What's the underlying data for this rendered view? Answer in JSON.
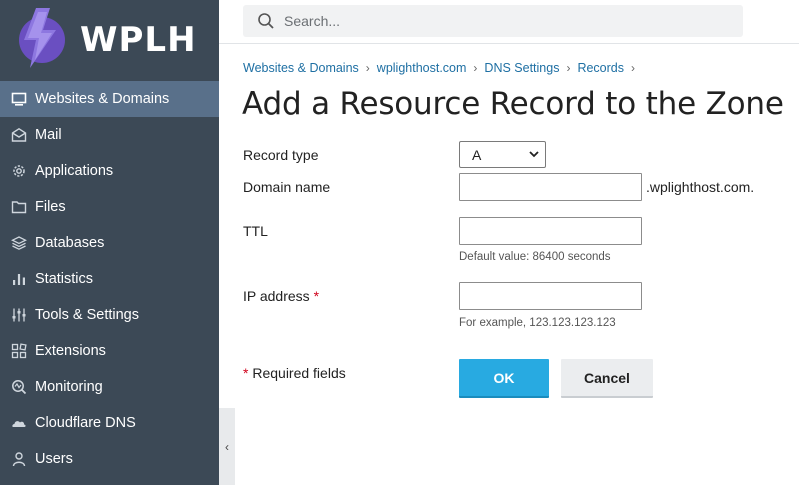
{
  "brand": {
    "logo_text": "WPLH",
    "accent": "#28aae1",
    "sidebar_bg": "#3c4956",
    "active_bg": "#59708a"
  },
  "search": {
    "placeholder": "Search..."
  },
  "sidebar": {
    "items": [
      {
        "label": "Websites & Domains",
        "icon": "monitor-icon",
        "active": true
      },
      {
        "label": "Mail",
        "icon": "envelope-icon"
      },
      {
        "label": "Applications",
        "icon": "gear-icon"
      },
      {
        "label": "Files",
        "icon": "folder-icon"
      },
      {
        "label": "Databases",
        "icon": "layers-icon"
      },
      {
        "label": "Statistics",
        "icon": "bar-chart-icon"
      },
      {
        "label": "Tools & Settings",
        "icon": "sliders-icon"
      },
      {
        "label": "Extensions",
        "icon": "extensions-icon"
      },
      {
        "label": "Monitoring",
        "icon": "monitoring-icon"
      },
      {
        "label": "Cloudflare DNS",
        "icon": "cloud-icon"
      },
      {
        "label": "Users",
        "icon": "user-icon"
      }
    ],
    "collapse_glyph": "‹"
  },
  "breadcrumb": [
    "Websites & Domains",
    "wplighthost.com",
    "DNS Settings",
    "Records"
  ],
  "breadcrumb_sep": "›",
  "page": {
    "title": "Add a Resource Record to the Zone"
  },
  "form": {
    "record_type": {
      "label": "Record type",
      "value": "A"
    },
    "domain_name": {
      "label": "Domain name",
      "value": "",
      "suffix": ".wplighthost.com."
    },
    "ttl": {
      "label": "TTL",
      "value": "",
      "hint": "Default value: 86400 seconds"
    },
    "ip_address": {
      "label": "IP address",
      "required_mark": "*",
      "value": "",
      "hint": "For example, 123.123.123.123"
    },
    "required_note": {
      "mark": "*",
      "text": "Required fields"
    },
    "ok_label": "OK",
    "cancel_label": "Cancel"
  }
}
